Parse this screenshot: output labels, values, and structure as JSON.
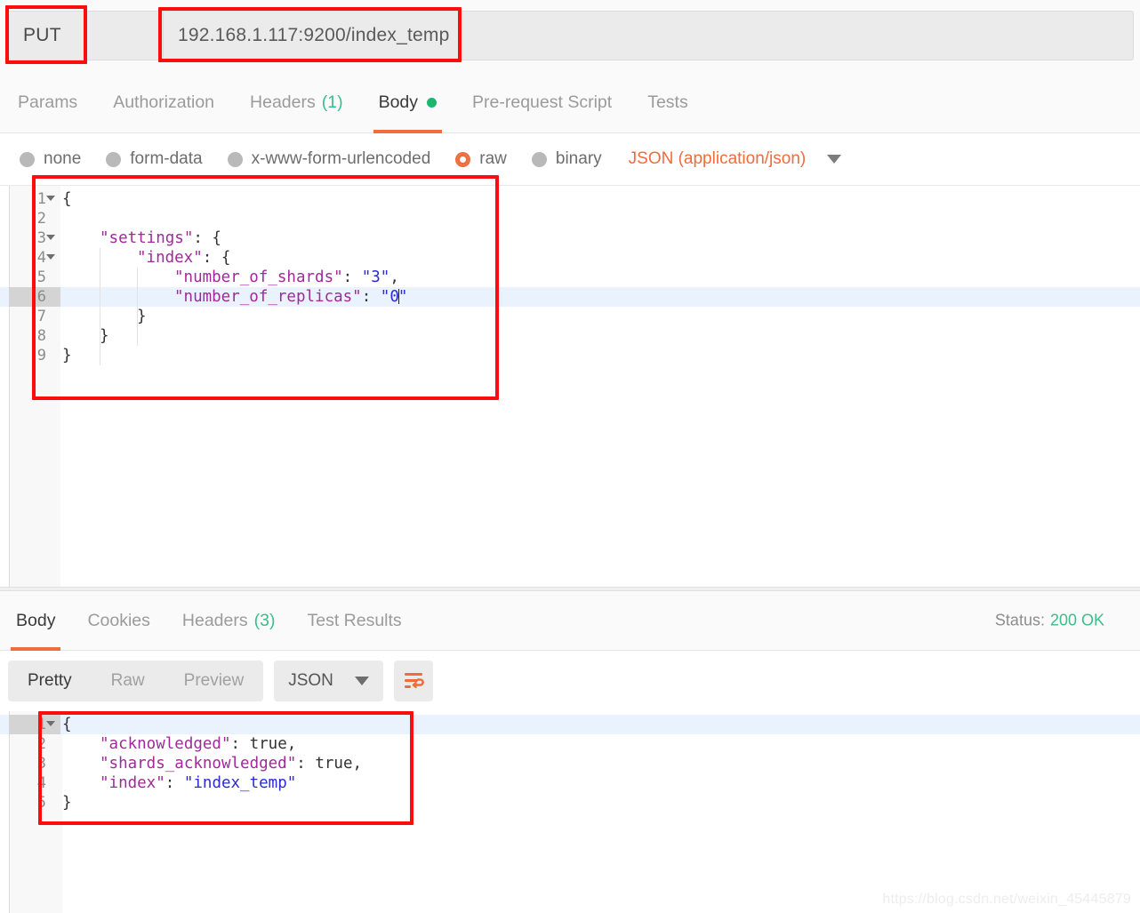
{
  "request_bar": {
    "method": "PUT",
    "method_caret_icon": "chevron-down-icon",
    "url_value": "192.168.1.117:9200/index_temp",
    "url_placeholder": "Enter request URL"
  },
  "request_tabs": [
    {
      "label": "Params",
      "active": false
    },
    {
      "label": "Authorization",
      "active": false
    },
    {
      "label": "Headers",
      "count": "(1)",
      "active": false
    },
    {
      "label": "Body",
      "active": true,
      "dot": true
    },
    {
      "label": "Pre-request Script",
      "active": false
    },
    {
      "label": "Tests",
      "active": false
    }
  ],
  "body_type": {
    "options": [
      {
        "label": "none",
        "selected": false
      },
      {
        "label": "form-data",
        "selected": false
      },
      {
        "label": "x-www-form-urlencoded",
        "selected": false
      },
      {
        "label": "raw",
        "selected": true
      },
      {
        "label": "binary",
        "selected": false
      }
    ],
    "content_type": "JSON (application/json)",
    "content_type_caret_icon": "chevron-down-icon"
  },
  "request_body": {
    "highlight_line": 6,
    "lines": [
      {
        "n": "1",
        "fold": true,
        "indent": 0,
        "tokens": [
          {
            "t": "{",
            "c": "p"
          }
        ]
      },
      {
        "n": "2",
        "fold": false,
        "indent": 0,
        "tokens": []
      },
      {
        "n": "3",
        "fold": true,
        "indent": 1,
        "tokens": [
          {
            "t": "\"settings\"",
            "c": "k"
          },
          {
            "t": ": {",
            "c": "p"
          }
        ]
      },
      {
        "n": "4",
        "fold": true,
        "indent": 2,
        "tokens": [
          {
            "t": "\"index\"",
            "c": "k"
          },
          {
            "t": ": {",
            "c": "p"
          }
        ]
      },
      {
        "n": "5",
        "fold": false,
        "indent": 3,
        "tokens": [
          {
            "t": "\"number_of_shards\"",
            "c": "k"
          },
          {
            "t": ": ",
            "c": "p"
          },
          {
            "t": "\"3\"",
            "c": "v"
          },
          {
            "t": ",",
            "c": "p"
          }
        ]
      },
      {
        "n": "6",
        "fold": false,
        "indent": 3,
        "tokens": [
          {
            "t": "\"number_of_replicas\"",
            "c": "k"
          },
          {
            "t": ": ",
            "c": "p"
          },
          {
            "t": "\"0",
            "c": "v"
          },
          {
            "t": "|",
            "c": "caret"
          },
          {
            "t": "\"",
            "c": "v"
          }
        ]
      },
      {
        "n": "7",
        "fold": false,
        "indent": 2,
        "tokens": [
          {
            "t": "}",
            "c": "p"
          }
        ]
      },
      {
        "n": "8",
        "fold": false,
        "indent": 1,
        "tokens": [
          {
            "t": "}",
            "c": "p"
          }
        ]
      },
      {
        "n": "9",
        "fold": false,
        "indent": 0,
        "tokens": [
          {
            "t": "}",
            "c": "p"
          }
        ]
      }
    ]
  },
  "response_tabs": [
    {
      "label": "Body",
      "active": true
    },
    {
      "label": "Cookies",
      "active": false
    },
    {
      "label": "Headers",
      "count": "(3)",
      "active": false
    },
    {
      "label": "Test Results",
      "active": false
    }
  ],
  "response_status": {
    "label": "Status:",
    "value": "200 OK"
  },
  "response_toolbar": {
    "view_modes": [
      {
        "label": "Pretty",
        "active": true
      },
      {
        "label": "Raw",
        "active": false
      },
      {
        "label": "Preview",
        "active": false
      }
    ],
    "format": "JSON",
    "format_caret_icon": "chevron-down-icon",
    "wrap_icon": "word-wrap-icon"
  },
  "response_body": {
    "highlight_line": 1,
    "lines": [
      {
        "n": "1",
        "fold": true,
        "indent": 0,
        "tokens": [
          {
            "t": "{",
            "c": "p"
          }
        ]
      },
      {
        "n": "2",
        "fold": false,
        "indent": 1,
        "tokens": [
          {
            "t": "\"acknowledged\"",
            "c": "k"
          },
          {
            "t": ": true,",
            "c": "p"
          }
        ]
      },
      {
        "n": "3",
        "fold": false,
        "indent": 1,
        "tokens": [
          {
            "t": "\"shards_acknowledged\"",
            "c": "k"
          },
          {
            "t": ": true,",
            "c": "p"
          }
        ]
      },
      {
        "n": "4",
        "fold": false,
        "indent": 1,
        "tokens": [
          {
            "t": "\"index\"",
            "c": "k"
          },
          {
            "t": ": ",
            "c": "p"
          },
          {
            "t": "\"index_temp\"",
            "c": "v"
          }
        ]
      },
      {
        "n": "5",
        "fold": false,
        "indent": 0,
        "tokens": [
          {
            "t": "}",
            "c": "p"
          }
        ]
      }
    ]
  },
  "annotations": {
    "color": "#fc0d0d",
    "boxes": [
      "method-selector",
      "url-input",
      "request-body-editor",
      "response-body-editor"
    ]
  },
  "watermark": "https://blog.csdn.net/weixin_45445879"
}
